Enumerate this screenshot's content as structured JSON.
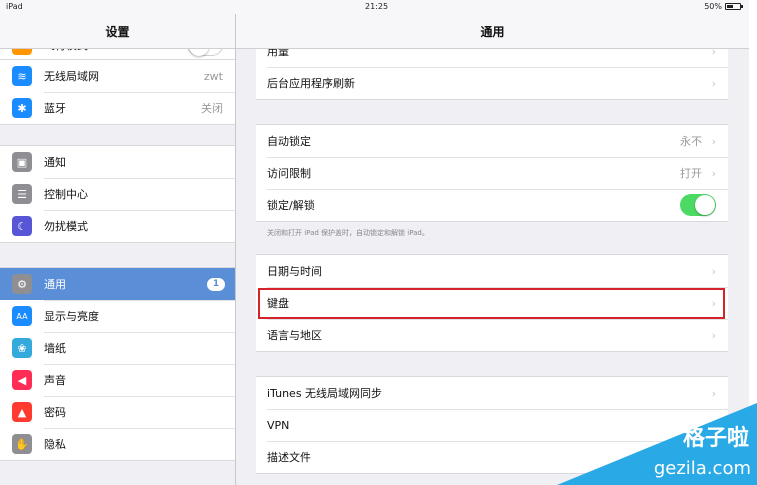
{
  "status": {
    "device": "iPad",
    "time": "21:25",
    "battery": "50%",
    "battery_level": 0.5
  },
  "sidebar": {
    "title": "设置",
    "top_partial_item": {
      "label": "飞行模式",
      "icon_color": "#ff9500",
      "toggle_on": false
    },
    "group1": [
      {
        "label": "无线局域网",
        "value": "zwt",
        "icon": "wifi-icon",
        "icon_glyph": "≋",
        "icon_color": "#1a8cff"
      },
      {
        "label": "蓝牙",
        "value": "关闭",
        "icon": "bluetooth-icon",
        "icon_glyph": "✱",
        "icon_color": "#1a8cff"
      }
    ],
    "group2": [
      {
        "label": "通知",
        "icon": "notification-icon",
        "icon_glyph": "▣",
        "icon_color": "#8e8e93"
      },
      {
        "label": "控制中心",
        "icon": "control-center-icon",
        "icon_glyph": "☰",
        "icon_color": "#8e8e93"
      },
      {
        "label": "勿扰模式",
        "icon": "moon-icon",
        "icon_glyph": "☾",
        "icon_color": "#5856d6"
      }
    ],
    "group3": [
      {
        "label": "通用",
        "badge": "1",
        "icon": "gear-icon",
        "icon_glyph": "⚙",
        "icon_color": "#8e8e93",
        "selected": true
      },
      {
        "label": "显示与亮度",
        "icon": "display-icon",
        "icon_glyph": "AA",
        "icon_color": "#1a8cff"
      },
      {
        "label": "墙纸",
        "icon": "wallpaper-icon",
        "icon_glyph": "❀",
        "icon_color": "#34aadc"
      },
      {
        "label": "声音",
        "icon": "sound-icon",
        "icon_glyph": "◀",
        "icon_color": "#ff2d55"
      },
      {
        "label": "密码",
        "icon": "lock-icon",
        "icon_glyph": "▲",
        "icon_color": "#ff3b30"
      },
      {
        "label": "隐私",
        "icon": "privacy-hand-icon",
        "icon_glyph": "✋",
        "icon_color": "#8e8e93"
      }
    ]
  },
  "main": {
    "title": "通用",
    "group1": [
      {
        "label": "用量"
      },
      {
        "label": "后台应用程序刷新"
      }
    ],
    "group2": [
      {
        "label": "自动锁定",
        "value": "永不"
      },
      {
        "label": "访问限制",
        "value": "打开"
      },
      {
        "label": "锁定/解锁",
        "toggle_on": true
      }
    ],
    "group2_footnote": "关闭和打开 iPad 保护盖时，自动锁定和解锁 iPad。",
    "group3": [
      {
        "label": "日期与时间"
      },
      {
        "label": "键盘",
        "highlighted": true
      },
      {
        "label": "语言与地区"
      }
    ],
    "group4": [
      {
        "label": "iTunes 无线局域网同步"
      },
      {
        "label": "VPN"
      },
      {
        "label": "描述文件"
      }
    ]
  },
  "watermark": {
    "line1": "格子啦",
    "line2": "gezila.com",
    "color": "#29a9e6"
  }
}
